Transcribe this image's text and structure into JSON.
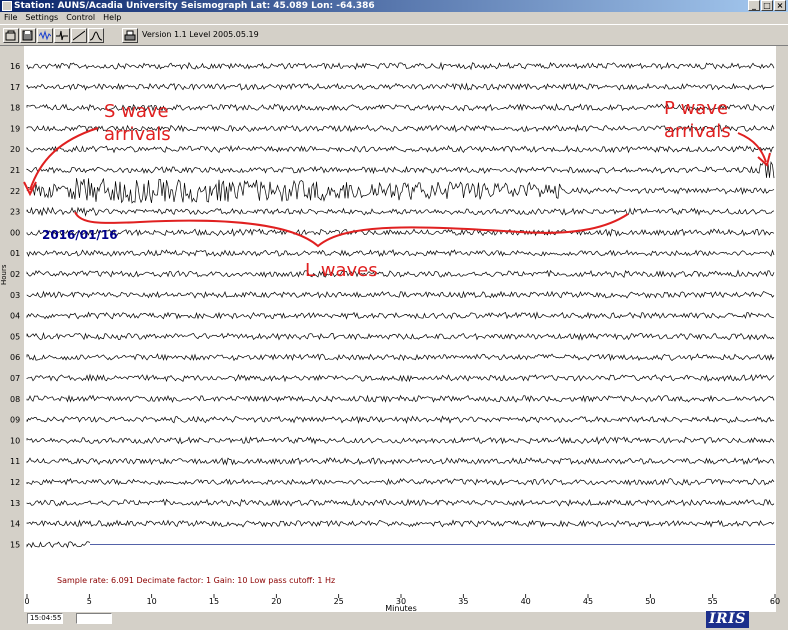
{
  "window": {
    "title": "Station: AUNS/Acadia University Seismograph Lat: 45.089 Lon: -64.386"
  },
  "window_buttons": [
    "_",
    "□",
    "×"
  ],
  "menu": [
    "File",
    "Settings",
    "Control",
    "Help"
  ],
  "toolbar": {
    "version": "Version 1.1 Level 2005.05.19"
  },
  "hour_labels": [
    "16",
    "17",
    "18",
    "19",
    "20",
    "21",
    "22",
    "23",
    "00",
    "01",
    "02",
    "03",
    "04",
    "05",
    "06",
    "07",
    "08",
    "09",
    "10",
    "11",
    "12",
    "13",
    "14",
    "15"
  ],
  "x_ticks": [
    "0",
    "5",
    "10",
    "15",
    "20",
    "25",
    "30",
    "35",
    "40",
    "45",
    "50",
    "55",
    "60"
  ],
  "x_axis_label": "Minutes",
  "y_axis_label": "Hours",
  "date_label": "2016/01/16",
  "sample_info": "Sample rate: 6.091  Decimate factor: 1  Gain: 10  Low pass cutoff: 1 Hz",
  "annotations": {
    "s_wave": [
      "S wave",
      "arrivals"
    ],
    "p_wave": [
      "P wave",
      "arrivals"
    ],
    "l_waves": "L waves"
  },
  "status": {
    "time": "15:04:55",
    "blank": ""
  },
  "logo": "IRIS",
  "colors": {
    "trace": "#000000",
    "annotation": "#e02020",
    "date": "#00008b",
    "axis_text": "#000000",
    "info_text": "#8b0000",
    "title_bar": "#0a246a"
  }
}
